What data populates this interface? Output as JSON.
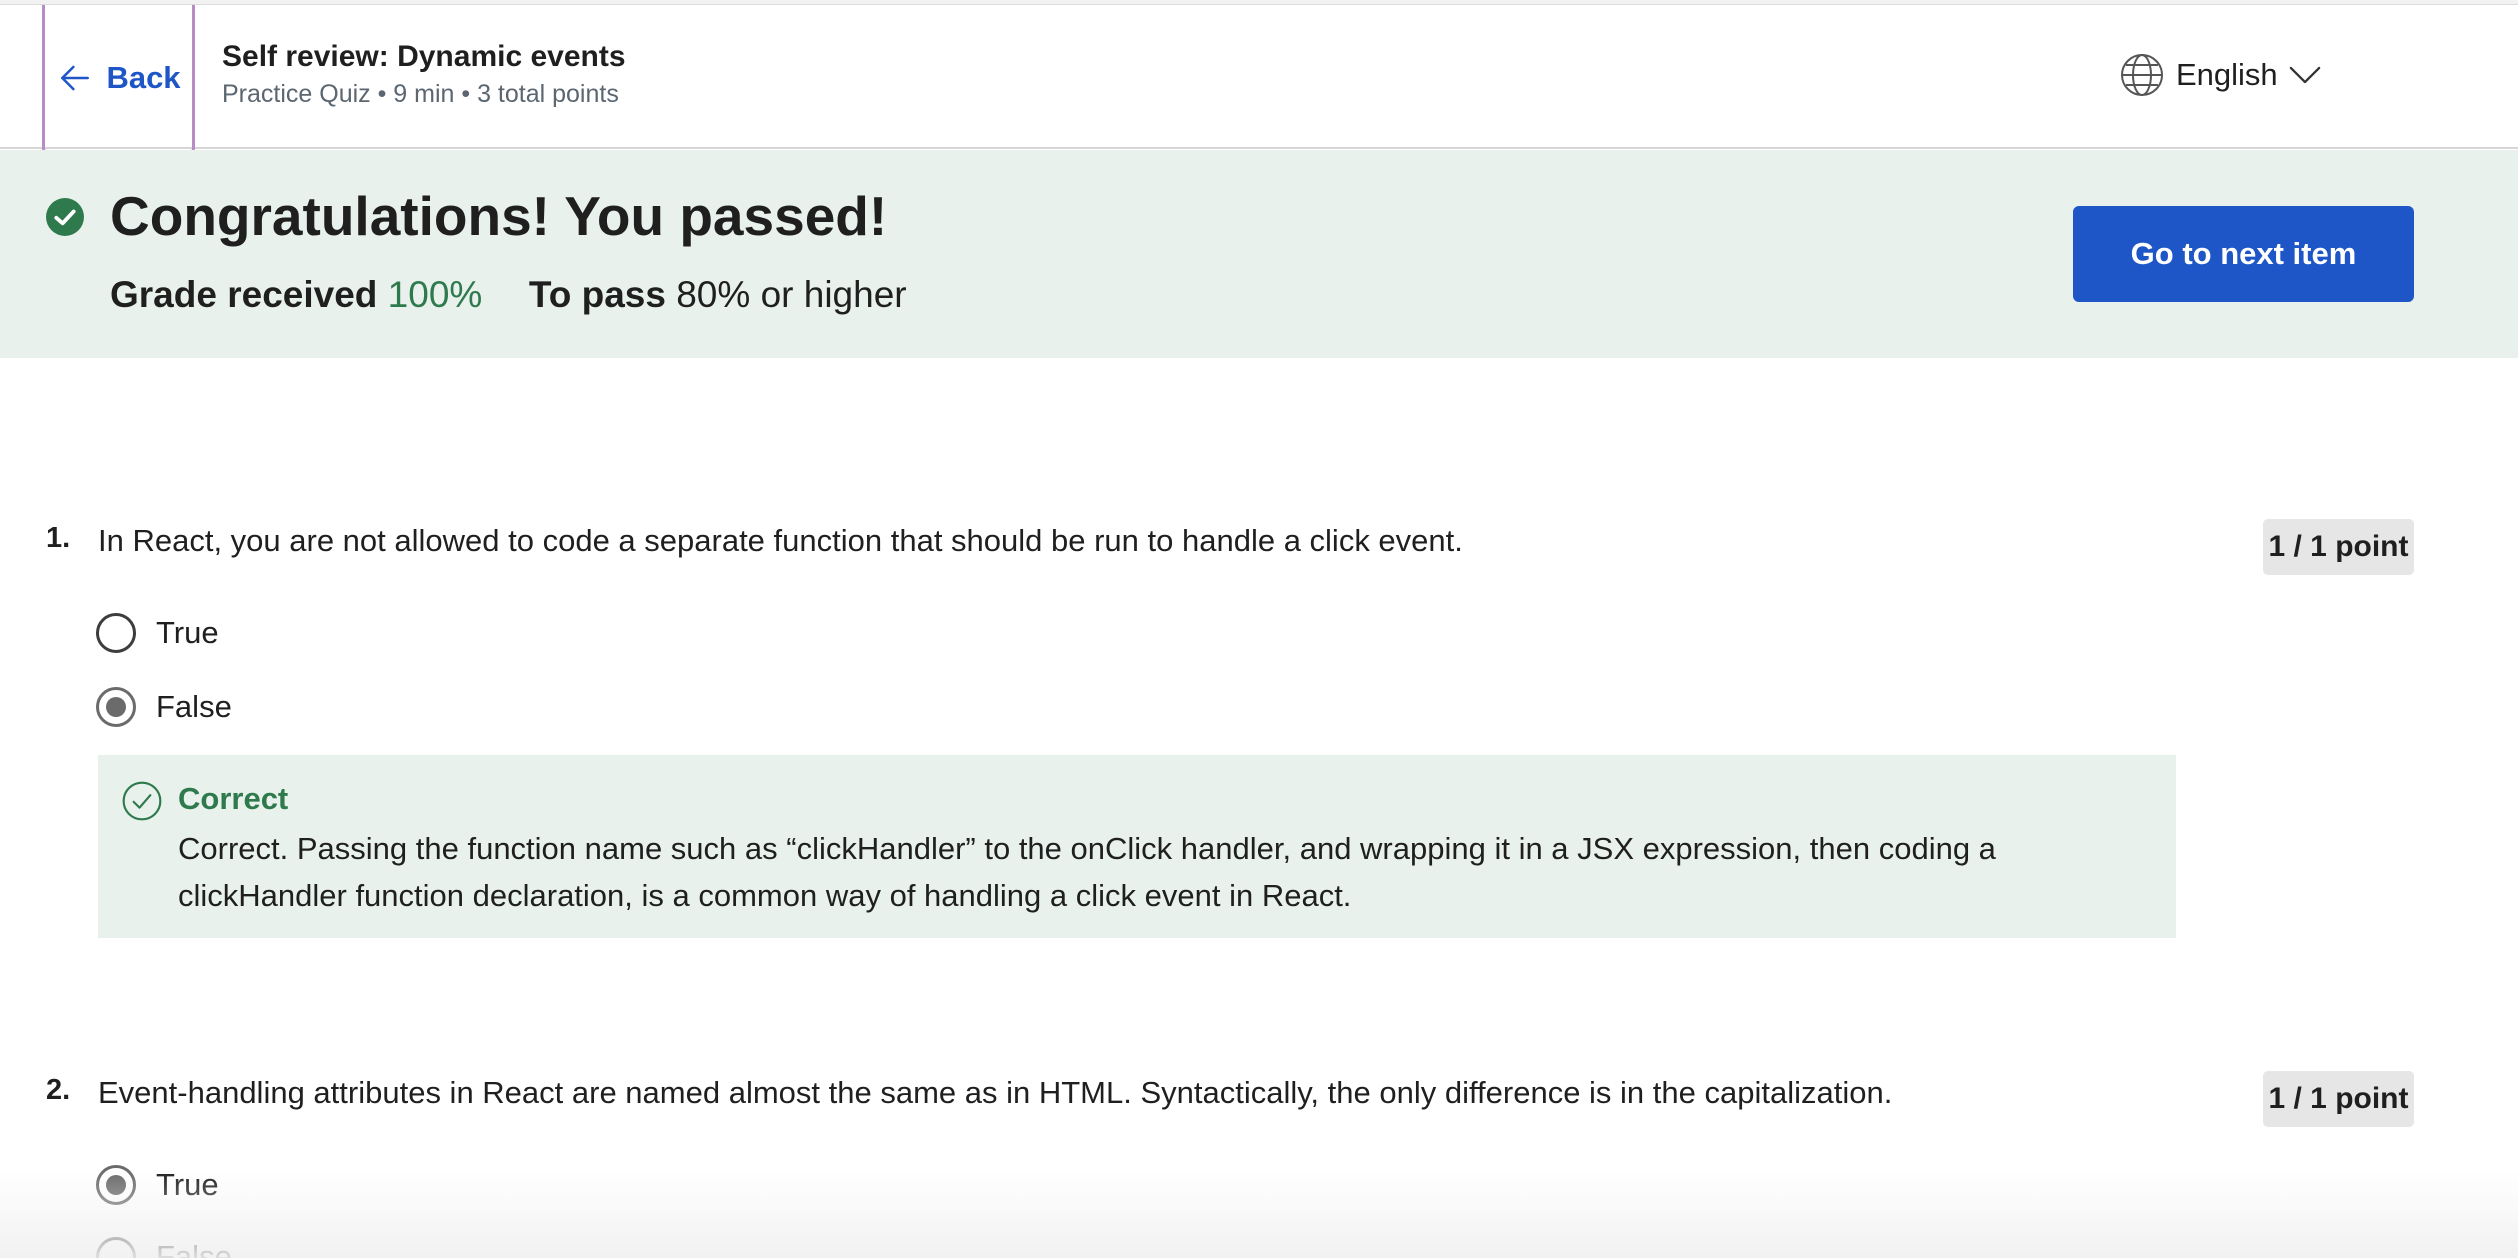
{
  "header": {
    "back_label": "Back",
    "title": "Self review: Dynamic events",
    "subtitle": "Practice Quiz • 9 min • 3 total points",
    "language": "English"
  },
  "banner": {
    "title": "Congratulations! You passed!",
    "grade_label": "Grade received",
    "grade_value": "100%",
    "pass_label": "To pass",
    "pass_value": "80% or higher",
    "next_button": "Go to next item"
  },
  "questions": [
    {
      "number": "1.",
      "text": "In React, you are not allowed to code a separate function that should be run to handle a click event.",
      "points": "1 / 1 point",
      "options": [
        {
          "label": "True",
          "selected": false
        },
        {
          "label": "False",
          "selected": true
        }
      ],
      "feedback": {
        "title": "Correct",
        "text": "Correct. Passing the function name such as “clickHandler” to the onClick handler, and wrapping it in a JSX expression, then coding a clickHandler function declaration, is a common way of handling a click event in React."
      }
    },
    {
      "number": "2.",
      "text": "Event-handling attributes in React are named almost the same as in HTML. Syntactically, the only difference is in the capitalization.",
      "points": "1 / 1 point",
      "options": [
        {
          "label": "True",
          "selected": true
        },
        {
          "label": "False",
          "selected": false
        }
      ]
    }
  ],
  "colors": {
    "accent": "#1e56c7",
    "success": "#2f7a4d",
    "banner_bg": "#e8f1ec",
    "focus_outline": "#b98bc7"
  },
  "icons": {
    "back": "arrow-left-icon",
    "language": "globe-icon",
    "dropdown": "chevron-down-icon",
    "passed": "check-circle-filled-icon",
    "correct": "check-circle-outline-icon"
  }
}
